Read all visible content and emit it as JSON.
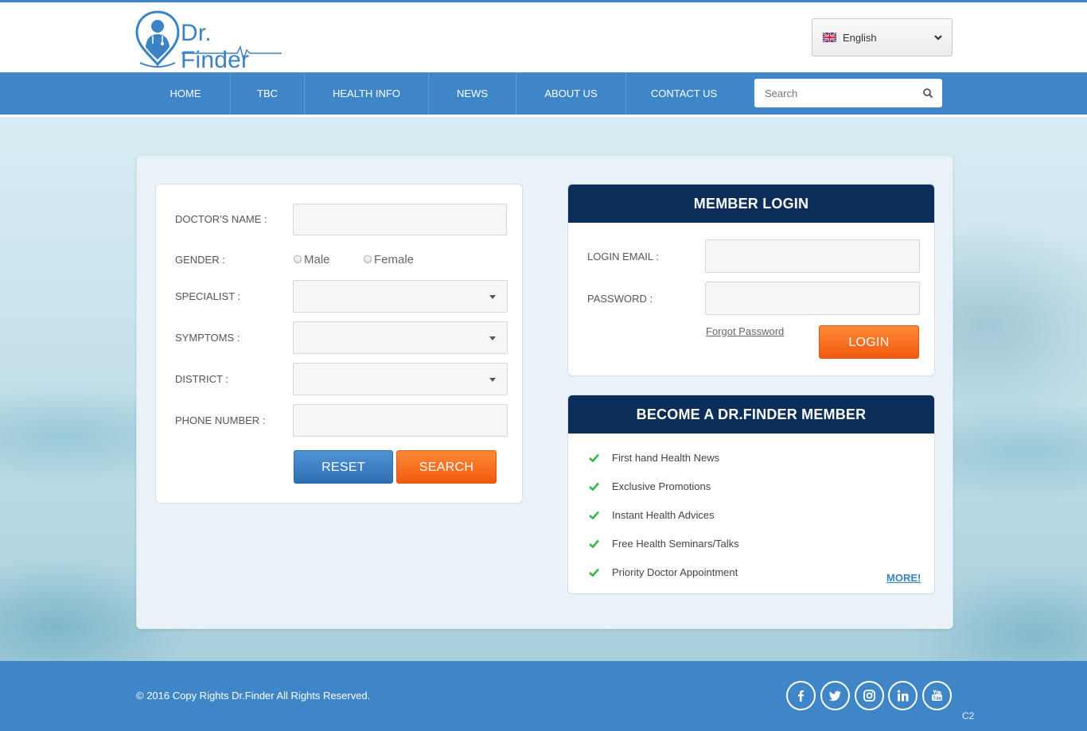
{
  "header": {
    "brand": "Dr. Finder",
    "language": {
      "selected": "English",
      "flag_icon": "uk-flag-icon"
    }
  },
  "nav": {
    "items": [
      "HOME",
      "TBC",
      "HEALTH INFO",
      "NEWS",
      "ABOUT US",
      "CONTACT US"
    ],
    "search_placeholder": "Search"
  },
  "search_form": {
    "doctor_name_label": "DOCTOR'S NAME  :",
    "gender_label": "GENDER :",
    "gender_options": [
      "Male",
      "Female"
    ],
    "specialist_label": "SPECIALIST :",
    "symptoms_label": "SYMPTOMS :",
    "district_label": "DISTRICT :",
    "phone_label": "PHONE NUMBER :",
    "reset_label": "RESET",
    "search_label": "SEARCH"
  },
  "login": {
    "title": "MEMBER LOGIN",
    "email_label": "LOGIN EMAIL :",
    "password_label": "PASSWORD :",
    "forgot_label": "Forgot Password",
    "login_button": "LOGIN"
  },
  "membership": {
    "title": "BECOME A DR.FINDER MEMBER",
    "benefits": [
      "First hand Health News",
      "Exclusive Promotions",
      "Instant Health Advices",
      "Free Health Seminars/Talks",
      "Priority Doctor Appointment"
    ],
    "more_label": "MORE!"
  },
  "footer": {
    "copyright": "© 2016 Copy Rights Dr.Finder All Rights Reserved.",
    "social": [
      "facebook-icon",
      "twitter-icon",
      "instagram-icon",
      "linkedin-icon",
      "youtube-icon"
    ],
    "code": "C2"
  },
  "colors": {
    "brand_blue": "#3f86c9",
    "navy": "#0b2d5a",
    "orange": "#f2590e",
    "check_green": "#3bb54a"
  }
}
